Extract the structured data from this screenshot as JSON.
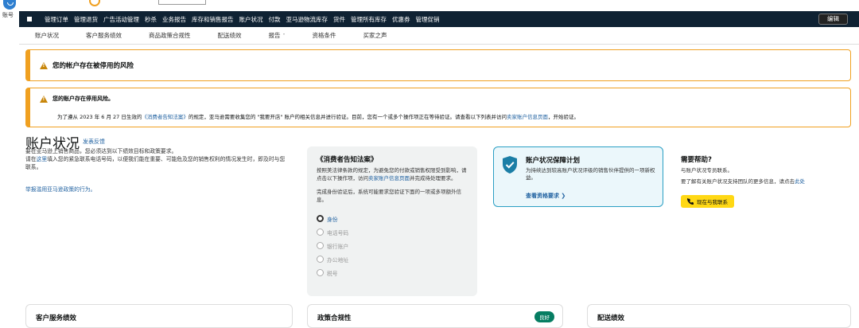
{
  "rail": {
    "label": "账号"
  },
  "nav": {
    "items": [
      "管理订单",
      "管理退货",
      "广告活动管理",
      "秒杀",
      "业务报告",
      "库存和销售报告",
      "账户状况",
      "付款",
      "亚马逊物流库存",
      "货件",
      "管理所有库存",
      "优惠券",
      "管理促销"
    ],
    "edit_label": "编辑"
  },
  "subnav": {
    "items": [
      "账户状况",
      "客户服务绩效",
      "商品政策合规性",
      "配送绩效",
      "报告",
      "资格条件",
      "买家之声"
    ]
  },
  "alert1": {
    "title": "您的帐户存在被停用的风险"
  },
  "alert2": {
    "title": "您的账户存在停用风险。",
    "body_pre": "为了遵从 2023 年 6 月 27 日生效的",
    "body_link": "《消费者告知法案》",
    "body_mid": "的规定，亚马逊需要收集您的 \"我要开店\" 账户的相关信息并进行验证。目前，您有一个或多个操作项正在等待验证。请查看以下列表并访问",
    "body_link2": "卖家账户信息页面",
    "body_post": "，开始验证。"
  },
  "status": {
    "title": "账户状况",
    "feedback": "发表反馈",
    "desc_1": "要在亚马逊上销售商品，您必须达到以下绩效目标和政策要求。",
    "desc_2_pre": "请在",
    "desc_2_link": "这里",
    "desc_2_post": "填入您的紧急联系电话号码，以便我们能在重要、可能危及您的销售权利的情况发生时，即及时与您联系。",
    "report_link": "举报滥用亚马逊政策的行为。"
  },
  "law_card": {
    "title": "《消费者告知法案》",
    "text_pre": "按照美法律条款的规定，为避免您的付款或销售权限受到影响，请点击以下操作项，访问",
    "text_link": "卖家账户信息页面",
    "text_post": "并完成待处理要求。",
    "text2": "完成身份验证后，系统可能要求您验证下面的一项或多项额外信息。",
    "options": [
      "身份",
      "电话号码",
      "银行账户",
      "办公地址",
      "税号"
    ]
  },
  "plan_card": {
    "title": "账户状况保障计划",
    "text": "为持续达到较高账户状况评级的销售伙伴提供的一项新权益。",
    "link": "查看资格要求 ❯"
  },
  "help": {
    "title": "需要帮助?",
    "text1": "与账户状况专员联系。",
    "text2_pre": "要了解有关账户状况支持团队的更多信息，请点击",
    "text2_link": "此处",
    "button": "现在与我联系"
  },
  "bottom": {
    "card1": "客户服务绩效",
    "card2": "政策合规性",
    "card2_badge": "良好",
    "card3": "配送绩效"
  },
  "colors": {
    "nav_bg": "#0f2233",
    "warning": "#f0a020",
    "link": "#2162a1",
    "plan_border": "#2a9fc4",
    "button": "#ffd814",
    "good": "#067d62"
  }
}
